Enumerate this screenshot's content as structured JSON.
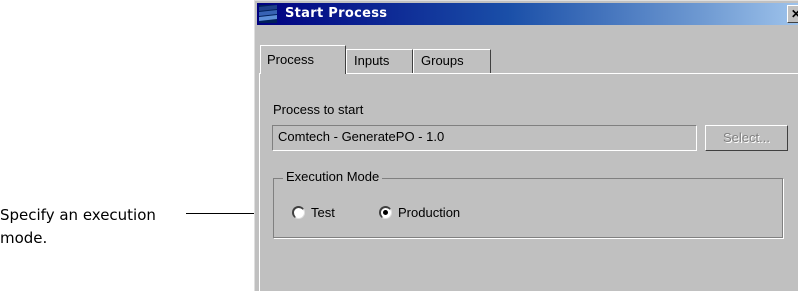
{
  "annotation": {
    "line1": "Specify an execution",
    "line2": "mode."
  },
  "window": {
    "title": "Start Process",
    "close_glyph": "✕"
  },
  "tabs": [
    {
      "label": "Process"
    },
    {
      "label": "Inputs"
    },
    {
      "label": "Groups"
    }
  ],
  "process": {
    "label": "Process to start",
    "value": "Comtech - GeneratePO - 1.0",
    "select_label": "Select..."
  },
  "execution_mode": {
    "legend": "Execution Mode",
    "options": [
      {
        "label": "Test",
        "checked": false
      },
      {
        "label": "Production",
        "checked": true
      }
    ]
  },
  "colors": {
    "titlebar_start": "#000080",
    "titlebar_end": "#a6caf0",
    "window_bg": "#c0c0c0"
  },
  "icons": [
    "app-icon",
    "close-icon",
    "radio-icon"
  ]
}
